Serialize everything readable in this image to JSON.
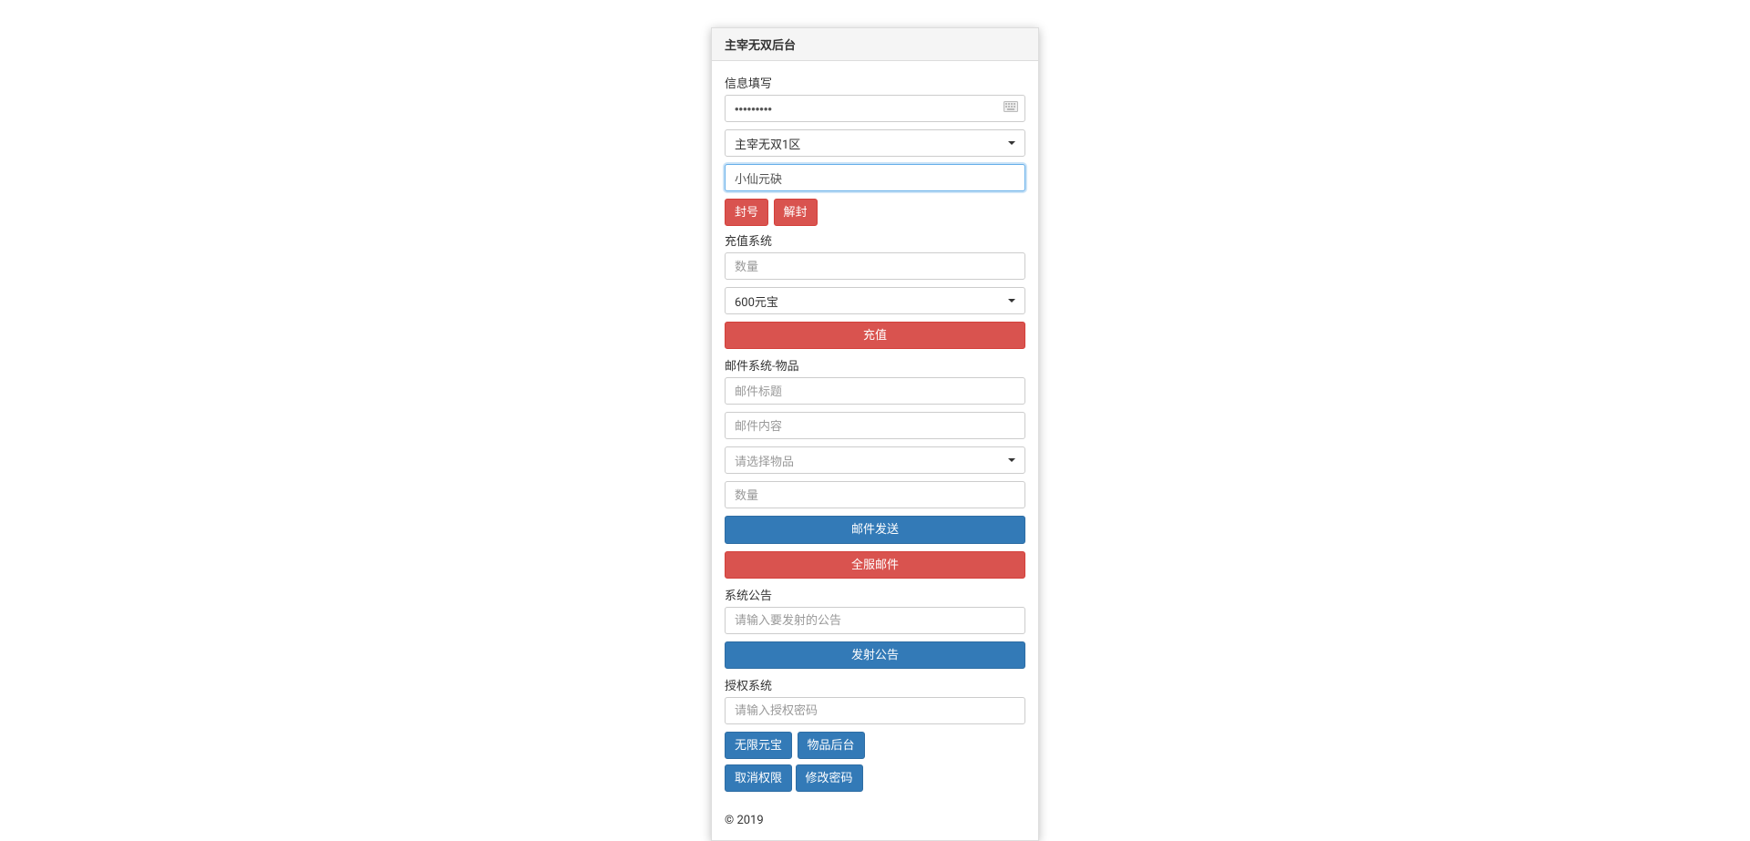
{
  "header": {
    "title": "主宰无双后台"
  },
  "info_section": {
    "label": "信息填写",
    "password_value": "•••••••••",
    "server_selected": "主宰无双1区",
    "player_value": "小仙元砄",
    "ban_label": "封号",
    "unban_label": "解封"
  },
  "recharge_section": {
    "label": "充值系统",
    "qty_placeholder": "数量",
    "type_selected": "600元宝",
    "submit_label": "充值"
  },
  "mail_section": {
    "label": "邮件系统-物品",
    "title_placeholder": "邮件标题",
    "content_placeholder": "邮件内容",
    "item_selected": "请选择物品",
    "qty_placeholder": "数量",
    "send_label": "邮件发送",
    "broadcast_label": "全服邮件"
  },
  "announce_section": {
    "label": "系统公告",
    "placeholder": "请输入要发射的公告",
    "submit_label": "发射公告"
  },
  "auth_section": {
    "label": "授权系统",
    "placeholder": "请输入授权密码",
    "btn_unlimited": "无限元宝",
    "btn_item_admin": "物品后台",
    "btn_revoke": "取消权限",
    "btn_change_pwd": "修改密码"
  },
  "footer": {
    "copyright": "© 2019"
  }
}
